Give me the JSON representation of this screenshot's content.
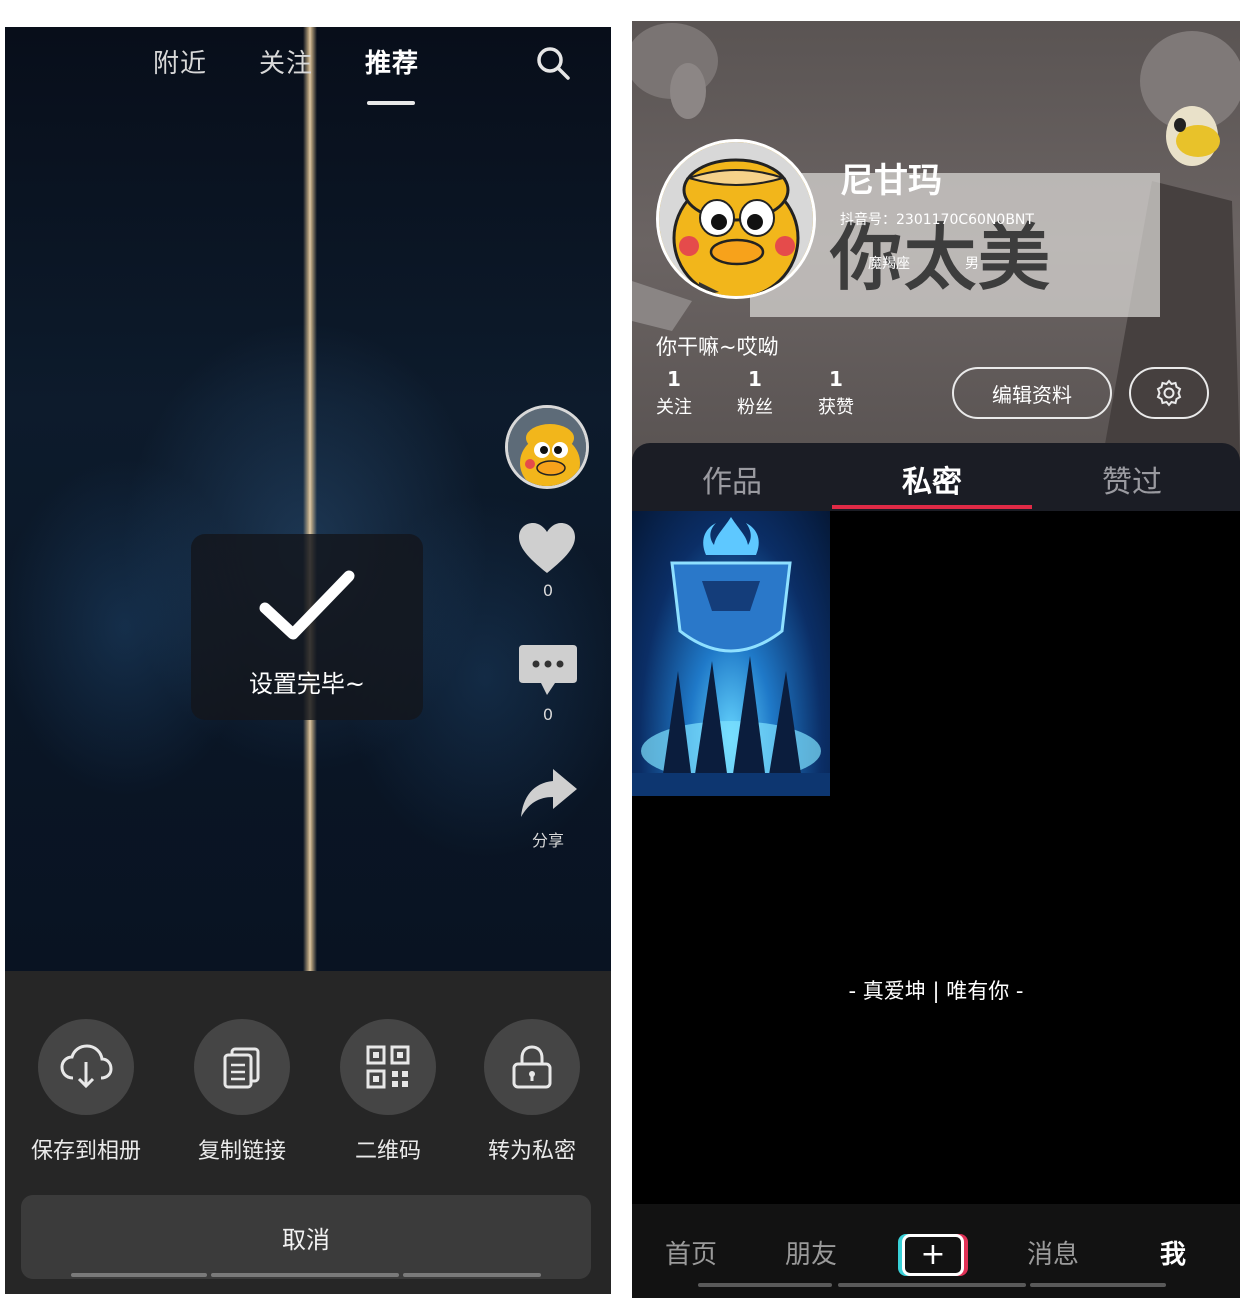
{
  "left": {
    "top_tabs": [
      {
        "label": "附近",
        "active": false
      },
      {
        "label": "关注",
        "active": false
      },
      {
        "label": "推荐",
        "active": true
      }
    ],
    "icons": {
      "search": "search-icon",
      "like": "heart-icon",
      "comment": "comment-icon",
      "share": "share-arrow-icon"
    },
    "rail": {
      "like_count": "0",
      "comment_count": "0",
      "share_label": "分享"
    },
    "toast": {
      "text": "设置完毕~"
    },
    "share_actions": [
      {
        "label": "保存到相册",
        "icon": "cloud-download-icon"
      },
      {
        "label": "复制链接",
        "icon": "copy-link-icon"
      },
      {
        "label": "二维码",
        "icon": "qrcode-icon"
      },
      {
        "label": "转为私密",
        "icon": "lock-icon"
      }
    ],
    "cancel_label": "取消"
  },
  "right": {
    "profile": {
      "nickname": "尼甘玛",
      "account_id": "抖音号：2301170C60N0BNT",
      "zodiac": "魔羯座",
      "gender": "男",
      "bio": "你干嘛~哎呦",
      "banner_text": "你太美"
    },
    "stats": [
      {
        "value": "1",
        "label": "关注"
      },
      {
        "value": "1",
        "label": "粉丝"
      },
      {
        "value": "1",
        "label": "获赞"
      }
    ],
    "edit_label": "编辑资料",
    "tabs": [
      {
        "label": "作品",
        "active": false
      },
      {
        "label": "私密",
        "active": true
      },
      {
        "label": "赞过",
        "active": false
      }
    ],
    "slogan": "- 真爱坤 | 唯有你 -",
    "bottom_nav": [
      {
        "label": "首页",
        "active": false
      },
      {
        "label": "朋友",
        "active": false
      },
      {
        "label": "+",
        "active": false
      },
      {
        "label": "消息",
        "active": false
      },
      {
        "label": "我",
        "active": true
      }
    ],
    "colors": {
      "accent": "#e12a46",
      "cyan": "#39d1d8"
    }
  }
}
